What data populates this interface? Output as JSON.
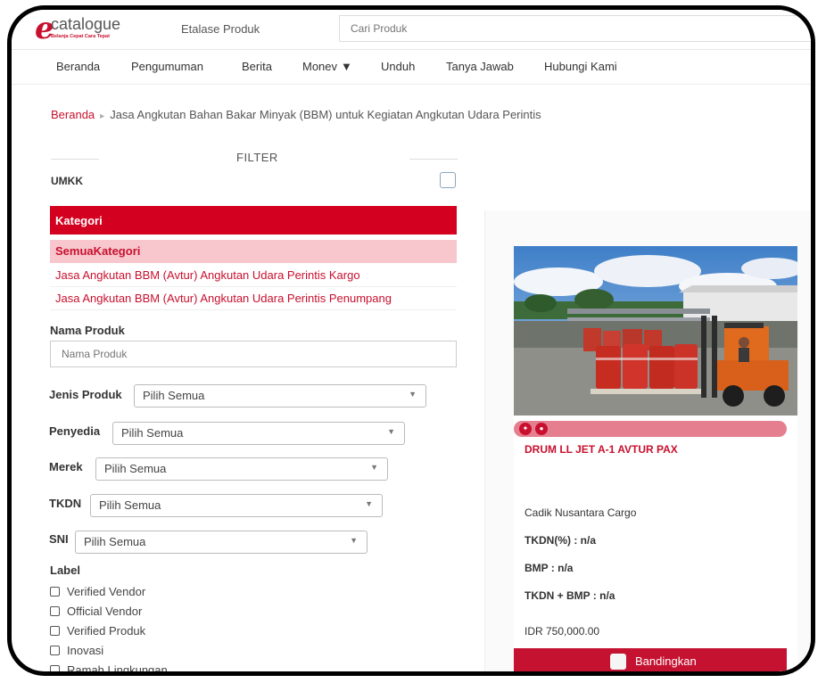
{
  "header": {
    "logo_name": "catalogue",
    "logo_tagline": "Belanja Cepat Cara Tepat",
    "etalase_label": "Etalase Produk",
    "search_placeholder": "Cari Produk"
  },
  "nav": {
    "items": [
      "Beranda",
      "Pengumuman",
      "Berita",
      "Monev",
      "Unduh",
      "Tanya Jawab",
      "Hubungi Kami"
    ]
  },
  "breadcrumb": {
    "home": "Beranda",
    "current": "Jasa Angkutan Bahan Bakar Minyak (BBM) untuk Kegiatan Angkutan Udara Perintis"
  },
  "filter": {
    "title": "FILTER",
    "umkk_label": "UMKK",
    "umkk_checked": false,
    "kategori_header": "Kategori",
    "kategori_all": "SemuaKategori",
    "kategori_items": [
      "Jasa Angkutan BBM (Avtur) Angkutan Udara Perintis Kargo",
      "Jasa Angkutan BBM (Avtur) Angkutan Udara Perintis Penumpang"
    ],
    "nama_produk_label": "Nama Produk",
    "nama_produk_placeholder": "Nama Produk",
    "jenis_label": "Jenis Produk",
    "jenis_value": "Pilih Semua",
    "penyedia_label": "Penyedia",
    "penyedia_value": "Pilih Semua",
    "merek_label": "Merek",
    "merek_value": "Pilih Semua",
    "tkdn_label": "TKDN",
    "tkdn_value": "Pilih Semua",
    "sni_label": "SNI",
    "sni_value": "Pilih Semua",
    "label_title": "Label",
    "label_options": [
      "Verified Vendor",
      "Official Vendor",
      "Verified Produk",
      "Inovasi",
      "Ramah Lingkungan"
    ]
  },
  "product": {
    "name": "DRUM LL JET A-1 AVTUR PAX",
    "vendor": "Cadik Nusantara Cargo",
    "tkdn": "TKDN(%) : n/a",
    "bmp": "BMP : n/a",
    "tkdn_bmp": "TKDN + BMP : n/a",
    "price": "IDR 750,000.00",
    "compare_label": "Bandingkan"
  },
  "colors": {
    "brand_red": "#c8102e",
    "kategori_bg": "#d4001f",
    "kategori_all_bg": "#f7c7cd",
    "badge_bar": "#e57f90"
  }
}
